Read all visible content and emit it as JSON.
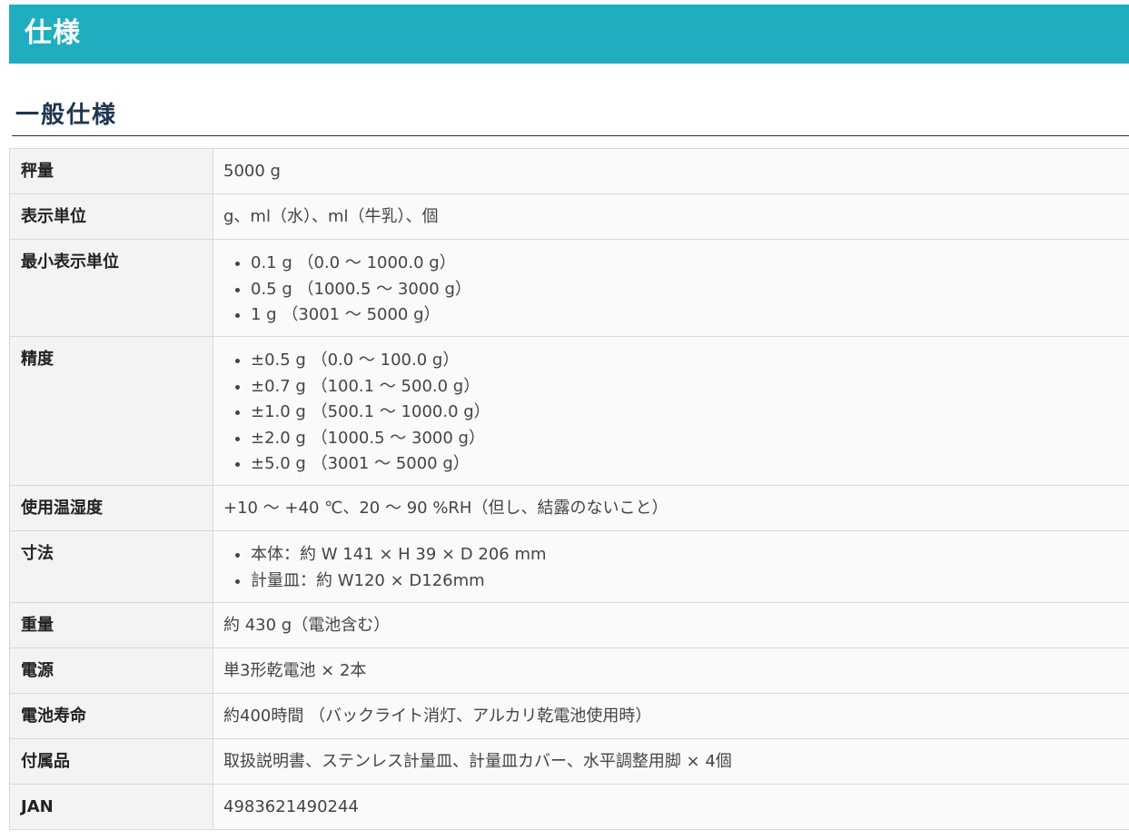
{
  "header": {
    "title": "仕様"
  },
  "section": {
    "title": "一般仕様"
  },
  "colors": {
    "header_bg": "#1eaec0",
    "section_title": "#1e3550"
  },
  "specs": {
    "capacity": {
      "label": "秤量",
      "value": "5000 g"
    },
    "display_units": {
      "label": "表示単位",
      "value": "g、ml（水）、ml（牛乳）、個"
    },
    "min_display": {
      "label": "最小表示単位",
      "items": [
        "0.1 g （0.0 ～ 1000.0 g）",
        "0.5 g （1000.5 ～ 3000 g）",
        "1 g （3001 ～ 5000 g）"
      ]
    },
    "accuracy": {
      "label": "精度",
      "items": [
        "±0.5 g （0.0 ～ 100.0 g）",
        "±0.7 g （100.1 ～ 500.0 g）",
        "±1.0 g （500.1 ～ 1000.0 g）",
        "±2.0 g （1000.5 ～ 3000 g）",
        "±5.0 g （3001 ～ 5000 g）"
      ]
    },
    "operating_env": {
      "label": "使用温湿度",
      "value": "+10 ～ +40 ℃、20 ～ 90 %RH（但し、結露のないこと）"
    },
    "dimensions": {
      "label": "寸法",
      "items": [
        "本体：約 W 141 × H 39 × D 206 mm",
        "計量皿：約 W120 × D126mm"
      ]
    },
    "weight": {
      "label": "重量",
      "value": "約 430 g（電池含む）"
    },
    "power": {
      "label": "電源",
      "value": "単3形乾電池 × 2本"
    },
    "battery_life": {
      "label": "電池寿命",
      "value": "約400時間 （バックライト消灯、アルカリ乾電池使用時）"
    },
    "accessories": {
      "label": "付属品",
      "value": "取扱説明書、ステンレス計量皿、計量皿カバー、水平調整用脚 × 4個"
    },
    "jan": {
      "label": "JAN",
      "value": "4983621490244"
    }
  }
}
